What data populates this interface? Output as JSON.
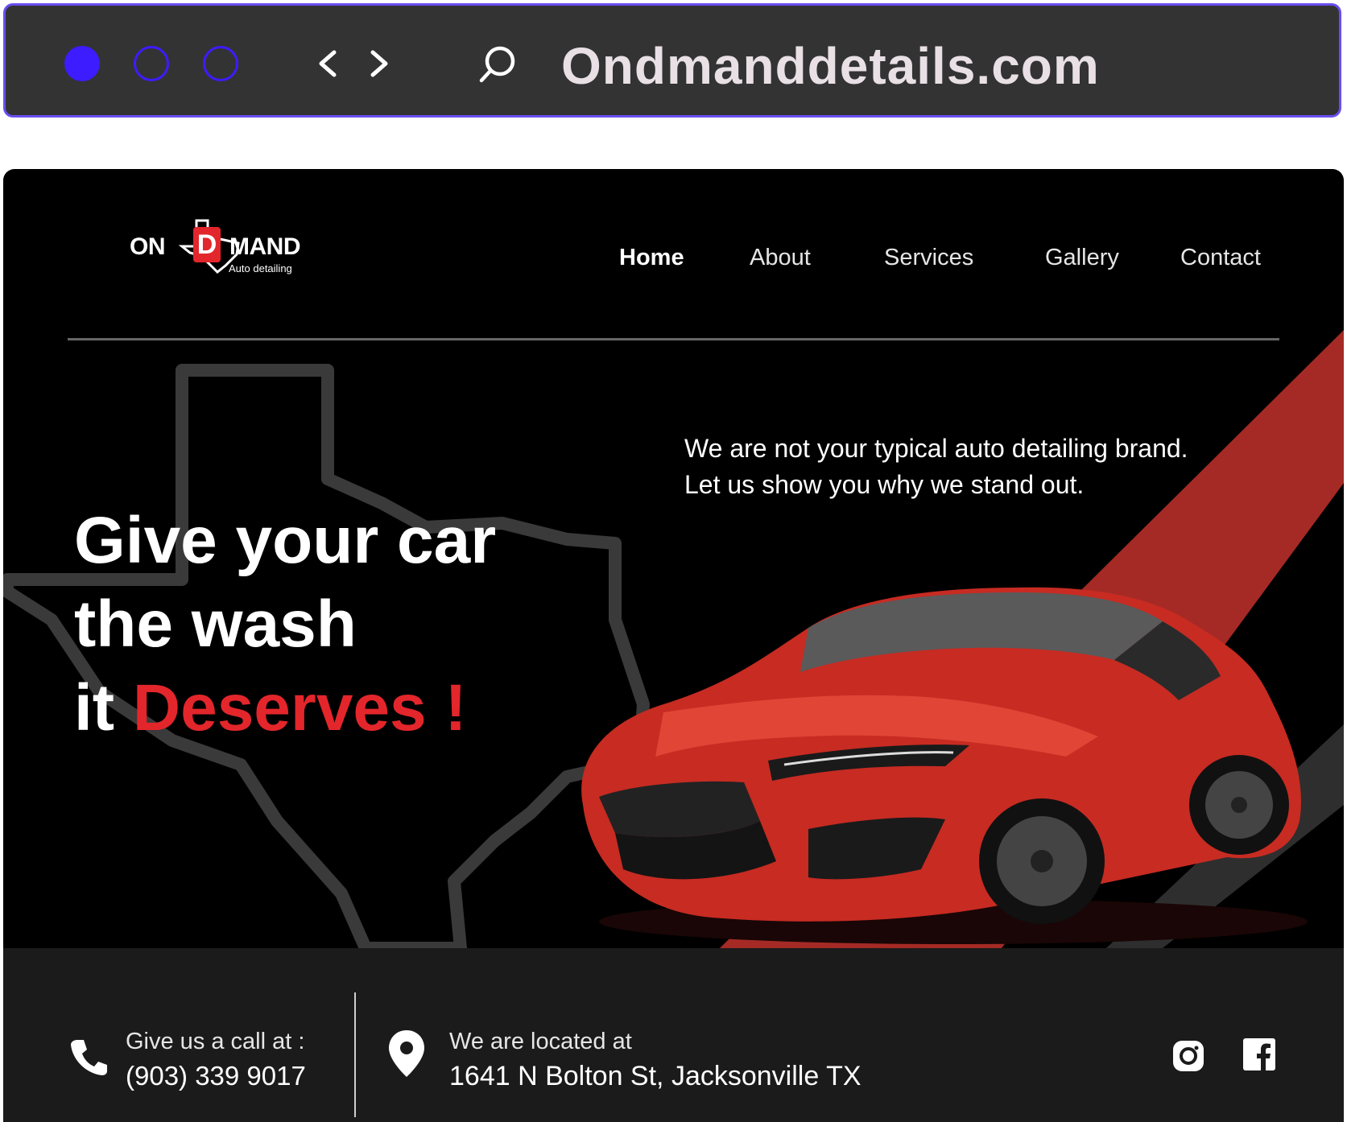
{
  "browser": {
    "url": "Ondmanddetails.com",
    "accent_color": "#3d1cff"
  },
  "logo": {
    "text_left": "ON",
    "text_d": "D",
    "text_right": "MAND",
    "subtitle": "Auto detailing"
  },
  "nav": {
    "items": [
      {
        "label": "Home",
        "active": true
      },
      {
        "label": "About"
      },
      {
        "label": "Services"
      },
      {
        "label": "Gallery"
      },
      {
        "label": "Contact"
      }
    ]
  },
  "hero": {
    "tagline_line1": "We are not your typical auto detailing brand.",
    "tagline_line2": "Let us show you why we stand out.",
    "headline_line1": "Give your car",
    "headline_line2": "the wash",
    "headline_line3_prefix": "it ",
    "headline_line3_highlight": "Deserves !",
    "accent_color": "#e3262b"
  },
  "footer": {
    "call_label": "Give us a call at :",
    "phone": "(903) 339 9017",
    "location_label": "We are located at",
    "address": "1641 N Bolton St, Jacksonville TX",
    "social": [
      "instagram-icon",
      "facebook-icon"
    ]
  }
}
